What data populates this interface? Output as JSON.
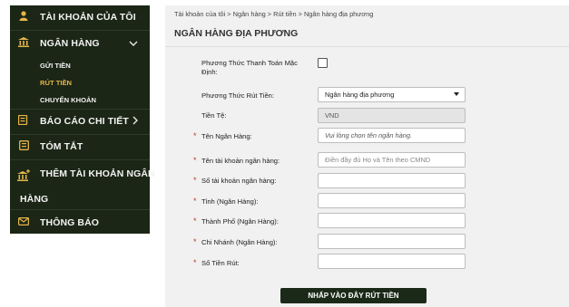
{
  "sidebar": {
    "account": {
      "label": "TÀI KHOẢN CỦA TÔI",
      "icon": "user-icon"
    },
    "bank": {
      "label": "NGÂN HÀNG",
      "icon": "bank-icon",
      "chevron": "chevron-down-icon",
      "subitems": [
        {
          "label": "GỬI TIỀN"
        },
        {
          "label": "RÚT TIỀN",
          "active": true
        },
        {
          "label": "CHUYỂN KHOẢN"
        }
      ]
    },
    "reports": {
      "label": "BÁO CÁO CHI TIẾT",
      "icon": "report-icon",
      "chevron": "chevron-right-icon"
    },
    "summary": {
      "label": "TÓM TẮT",
      "icon": "summary-icon"
    },
    "add_bank": {
      "label_line1": "THÊM TÀI KHOẢN NGÂN",
      "label_line2": "HÀNG",
      "icon": "bank-add-icon"
    },
    "notifications": {
      "label": "THÔNG BÁO",
      "icon": "envelope-icon"
    }
  },
  "breadcrumb": {
    "items": [
      "Tài khoản của tôi",
      "Ngân hàng",
      "Rút tiền",
      "Ngân hàng địa phương"
    ],
    "separator": ">"
  },
  "page_title": "NGÂN HÀNG ĐỊA PHƯƠNG",
  "form": {
    "default_payment": {
      "label_line1": "Phương Thức Thanh Toán Mặc",
      "label_line2": "Định:",
      "checked": false
    },
    "withdraw_method": {
      "label": "Phương Thức Rút Tiền:",
      "value": "Ngân hàng địa phương"
    },
    "currency": {
      "label": "Tiền Tệ:",
      "value": "VND"
    },
    "bank_name": {
      "label": "Tên Ngân Hàng:",
      "placeholder": "Vui lòng chọn tên ngân hàng."
    },
    "account_name": {
      "label": "Tên tài khoản ngân hàng:",
      "placeholder": "Điền đầy đủ Họ và Tên theo CMND"
    },
    "account_number": {
      "label": "Số tài khoản ngân hàng:",
      "value": ""
    },
    "province": {
      "label": "Tỉnh (Ngân Hàng):",
      "value": ""
    },
    "city": {
      "label": "Thành Phố (Ngân Hàng):",
      "value": ""
    },
    "branch": {
      "label": "Chi Nhánh (Ngân Hàng):",
      "value": ""
    },
    "amount": {
      "label": "Số Tiền Rút:",
      "value": ""
    },
    "required_marker": "*",
    "submit_label": "NHẤP VÀO ĐÂY RÚT TIỀN"
  },
  "colors": {
    "sidebar_bg": "#1b2616",
    "accent": "#e6b64b",
    "panel_bg": "#f1f1f1",
    "button_bg": "#1b2a18",
    "required": "#c0392b"
  }
}
